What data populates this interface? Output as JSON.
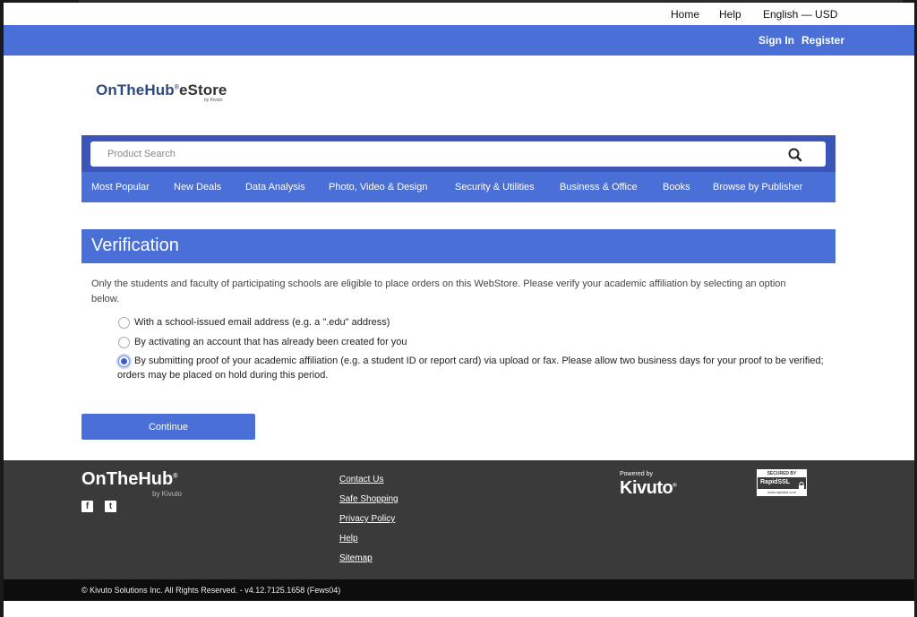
{
  "top_nav": {
    "home": "Home",
    "help": "Help",
    "locale": "English — USD"
  },
  "account_nav": {
    "sign_in": "Sign In",
    "register": "Register"
  },
  "logo": {
    "brand": "OnTheHub",
    "reg": "®",
    "store": "eStore",
    "by": "by Kivuto"
  },
  "search": {
    "placeholder": "Product Search",
    "value": ""
  },
  "categories": [
    "Most Popular",
    "New Deals",
    "Data Analysis",
    "Photo, Video & Design",
    "Security & Utilities",
    "Business & Office",
    "Books",
    "Browse by Publisher"
  ],
  "verification": {
    "title": "Verification",
    "intro": "Only the students and faculty of participating schools are eligible to place orders on this WebStore. Please verify your academic affiliation by selecting an option below.",
    "options": [
      {
        "label": "With a school-issued email address (e.g. a \".edu\" address)",
        "selected": false
      },
      {
        "label": "By activating an account that has already been created for you",
        "selected": false
      },
      {
        "label": "By submitting proof of your academic affiliation (e.g. a student ID or report card) via upload or fax. Please allow two business days for your proof to be verified; orders may be placed on hold during this period.",
        "selected": true
      }
    ],
    "continue_label": "Continue"
  },
  "footer": {
    "brand": "OnTheHub",
    "reg": "®",
    "by": "by Kivuto",
    "social": [
      {
        "icon": "facebook-icon",
        "glyph": "f"
      },
      {
        "icon": "twitter-icon",
        "glyph": "t"
      }
    ],
    "links": [
      "Contact Us",
      "Safe Shopping",
      "Privacy Policy",
      "Help",
      "Sitemap"
    ],
    "powered_by": "Powered by",
    "kivuto": "Kivuto",
    "kivuto_reg": "®",
    "ssl": {
      "top": "SECURED BY",
      "brand": "RapidSSL",
      "url": "www.rapidssl.com"
    },
    "copyright": "© Kivuto Solutions Inc. All Rights Reserved. - v4.12.7125.1658 (Fews04)"
  },
  "colors": {
    "primary": "#4a6fd6",
    "search_band": "#3c55b8",
    "footer": "#3a3a3a",
    "copyright_bar": "#0d0d0d"
  }
}
